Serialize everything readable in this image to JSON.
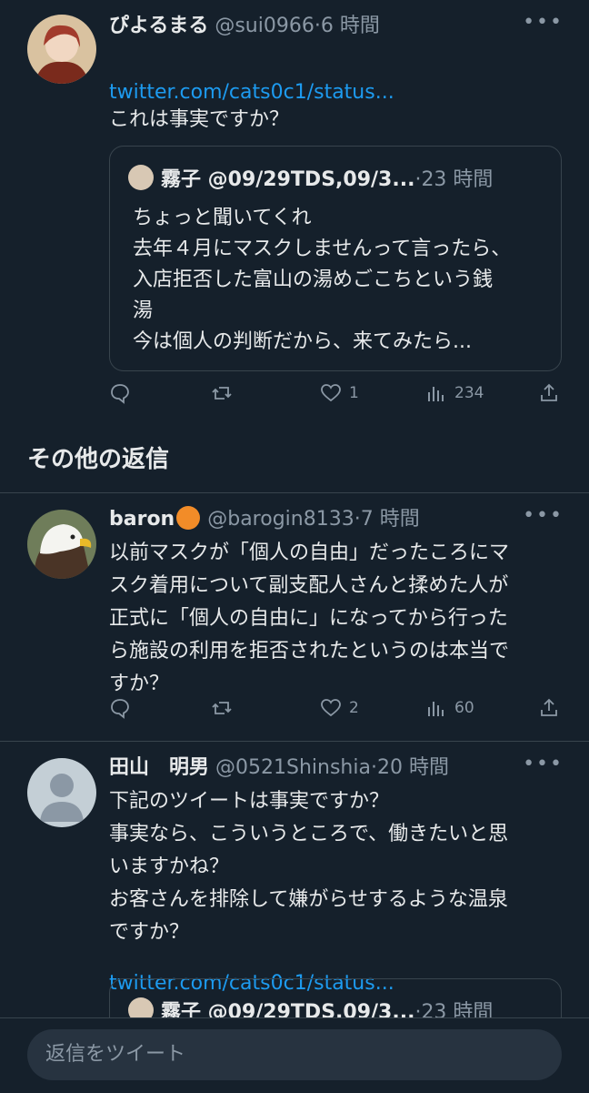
{
  "tweets": [
    {
      "name": "ぴよるまる",
      "handle": "@sui0966",
      "time": "6 時間",
      "link": "twitter.com/cats0c1/status...",
      "text": "これは事実ですか？",
      "quote": {
        "name": "霧子 @09/29TDS,09/3...",
        "time": "23 時間",
        "text": "ちょっと聞いてくれ\n去年４月にマスクしませんって言ったら、\n入店拒否した富山の湯めごこちという銭\n湯\n今は個人の判断だから、来てみたら..."
      },
      "likes": "1",
      "views": "234"
    },
    {
      "name": "baron",
      "handle": "@barogin8133",
      "time": "7 時間",
      "text": "以前マスクが「個人の自由」だったころにマ\nスク着用について副支配人さんと揉めた人が\n正式に「個人の自由に」になってから行った\nら施設の利用を拒否されたというのは本当で\nすか？",
      "likes": "2",
      "views": "60"
    },
    {
      "name": "田山　明男",
      "handle": "@0521Shinshia",
      "time": "20 時間",
      "text": "下記のツイートは事実ですか？\n事実なら、こういうところで、働きたいと思\nいますかね？\nお客さんを排除して嫌がらせするような温泉\nですか？",
      "link": "twitter.com/cats0c1/status...",
      "quote": {
        "name": "霧子 @09/29TDS,09/3...",
        "time": "23 時間"
      }
    }
  ],
  "section_title": "その他の返信",
  "separator": "·",
  "more_glyph": "•••",
  "reply_placeholder": "返信をツイート",
  "colors": {
    "background": "#15202b",
    "link": "#1d9bf0",
    "muted": "#8b98a5",
    "divider": "#38444d"
  }
}
